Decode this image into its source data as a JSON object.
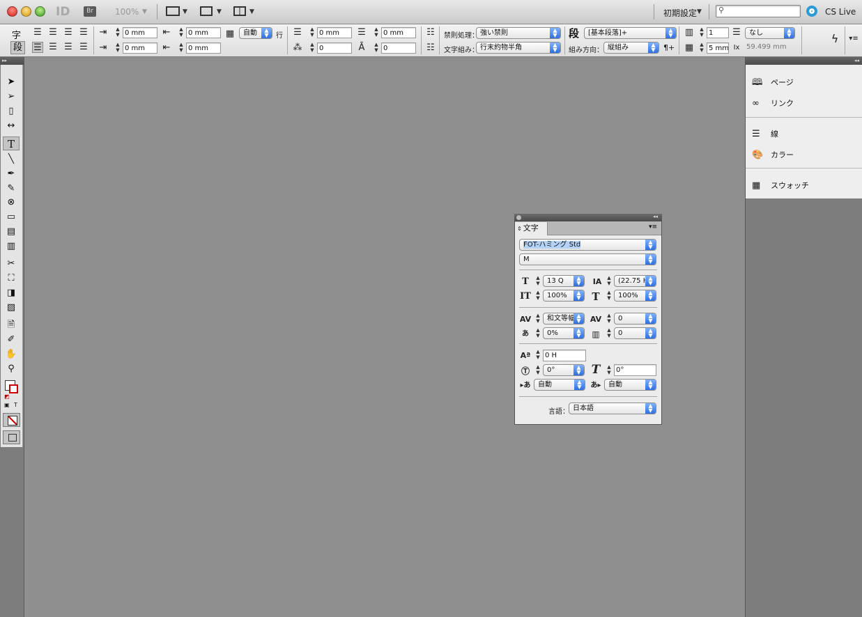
{
  "titlebar": {
    "app_icon": "ID",
    "bridge_label": "Br",
    "zoom": "100%",
    "workspace": "初期設定",
    "search_placeholder": "",
    "cs_live": "CS Live"
  },
  "controlbar": {
    "char_mode": "字",
    "para_mode": "段",
    "left_indent": "0 mm",
    "first_line_indent": "0 mm",
    "right_indent": "0 mm",
    "last_line_indent": "0 mm",
    "grid_auto": "自動",
    "grid_unit": "行",
    "space_before": "0 mm",
    "space_after": "0 mm",
    "drop_cap_lines": "0",
    "drop_cap_chars": "0",
    "kinsoku_label": "禁則処理：",
    "kinsoku_value": "強い禁則",
    "mojikumi_label": "文字組み：",
    "mojikumi_value": "行末約物半角",
    "para_style_icon": "段",
    "para_style_value": "[基本段落]+",
    "direction_label": "組み方向：",
    "direction_value": "縦組み",
    "columns": "1",
    "span_value": "なし",
    "gutter": "5 mm",
    "width_readout": "59.499 mm"
  },
  "dock": {
    "items": [
      "ページ",
      "リンク",
      "線",
      "カラー",
      "スウォッチ"
    ]
  },
  "char_panel": {
    "tab": "文字",
    "font_family": "FOT-ハミング Std",
    "font_style": "M",
    "size": "13 Q",
    "leading": "(22.75 H",
    "vertical_scale": "100%",
    "horizontal_scale": "100%",
    "kerning": "和文等幅",
    "tracking": "0",
    "tsume": "0%",
    "aki": "0",
    "baseline_shift": "0 H",
    "rotation": "0°",
    "skew": "0°",
    "aki_before": "自動",
    "aki_after": "自動",
    "language_label": "言語：",
    "language": "日本語"
  }
}
